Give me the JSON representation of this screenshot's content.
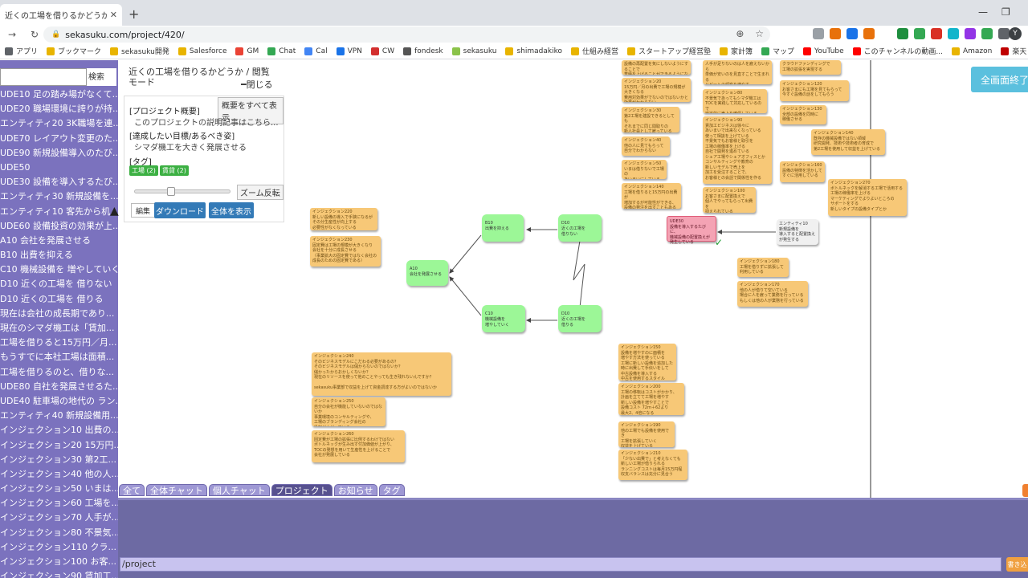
{
  "browser": {
    "tab_title": "近くの工場を借りるかどうか | 問題解",
    "tab_close": "✕",
    "new_tab": "+",
    "url": "sekasuku.com/project/420/",
    "lock": "🔒",
    "profile": "Y",
    "minimize": "—",
    "restore": "❐",
    "back": "←",
    "forward": "→",
    "reload": "↻",
    "zoom": "⊕",
    "star": "☆",
    "bookmarks": [
      {
        "label": "アプリ",
        "color": "#5f6368"
      },
      {
        "label": "ブックマーク",
        "color": "#e8b400"
      },
      {
        "label": "sekasuku開発",
        "color": "#e8b400"
      },
      {
        "label": "Salesforce",
        "color": "#e8b400"
      },
      {
        "label": "GM",
        "color": "#ea4335"
      },
      {
        "label": "Chat",
        "color": "#34a853"
      },
      {
        "label": "Cal",
        "color": "#4285f4"
      },
      {
        "label": "VPN",
        "color": "#1a73e8"
      },
      {
        "label": "CW",
        "color": "#d32f2f"
      },
      {
        "label": "fondesk",
        "color": "#555555"
      },
      {
        "label": "sekasuku",
        "color": "#8bc34a"
      },
      {
        "label": "shimadakiko",
        "color": "#e8b400"
      },
      {
        "label": "仕組み経営",
        "color": "#e8b400"
      },
      {
        "label": "スタートアップ経営塾",
        "color": "#e8b400"
      },
      {
        "label": "家計簿",
        "color": "#e8b400"
      },
      {
        "label": "マップ",
        "color": "#34a853"
      },
      {
        "label": "YouTube",
        "color": "#ff0000"
      },
      {
        "label": "このチャンネルの動画...",
        "color": "#ff0000"
      },
      {
        "label": "Amazon",
        "color": "#e8b400"
      },
      {
        "label": "楽天",
        "color": "#bf0000"
      },
      {
        "label": "楽天証券",
        "color": "#bf0000"
      }
    ]
  },
  "sidebar": {
    "search_button": "検索",
    "items": [
      "UDE10 足の踏み場がなくて...",
      "UDE20 職場環境に誇りが持...",
      "エンティティ20 3K職場を連...",
      "UDE70 レイアウト変更のた...",
      "UDE90 新規設備導入のたび...",
      "UDE50",
      "UDE30 設備を導入するたび...",
      "エンティティ30 新規設備を...",
      "エンティティ10 客先から机...",
      "UDE60 設備投資の効果が上...",
      "A10 会社を発展させる",
      "B10 出費を抑える",
      "C10 機械設備を 増やしていく",
      "D10 近くの工場を 借りない",
      "D10 近くの工場を 借りる",
      "現在は会社の成長期であり...",
      "現在のシマダ機工は「賃加...",
      "工場を借りると15万円／月...",
      "もうすでに本社工場は面積...",
      "工場を借りるのと、借りな...",
      "UDE80 自社を発展させるた...",
      "UDE40 駐車場の地代の ラン...",
      "エンティティ40 新規設備用...",
      "インジェクション10 出費の...",
      "インジェクション20 15万円...",
      "インジェクション30 第2工...",
      "インジェクション40 他の人...",
      "インジェクション50 いまは...",
      "インジェクション60 工場を...",
      "インジェクション70 人手が...",
      "インジェクション80 不景気...",
      "インジェクション110 クラ...",
      "インジェクション100 お客...",
      "インジェクション90 賃加工..."
    ]
  },
  "project_panel": {
    "title": "近くの工場を借りるかどうか / 閲覧モード",
    "close": "━閉じる",
    "show_all": "概要をすべて表示",
    "overview_label": "[プロジェクト概要]",
    "overview_text": "このプロジェクトの説明記事はこちら...",
    "goal_label": "[達成したい目標/あるべき姿]",
    "goal_text": "シマダ機工を大きく発展させる",
    "tag_label": "[タグ]",
    "tags": [
      "工場 (2)",
      "賃貸 (2)"
    ],
    "zoom_flip": "ズーム反転",
    "edit": "編集",
    "download": "ダウンロード",
    "show_all_view": "全体を表示"
  },
  "canvas": {
    "fullscreen": "全画面終了",
    "check": "✓",
    "green_nodes": {
      "a10": "A10\n会社を発展させる",
      "b10": "B10\n出費を抑える",
      "c10": "C10\n機械設備を\n増やしていく",
      "d10_top": "D10\n近くの工場を\n借りない",
      "d10_bottom": "D10\n近くの工場を\n借りる"
    },
    "pink_node": "UDE30\n設備を導入するたびに、\n機械設備の配置換えが\n発生している",
    "gray_node": "エンティティ10\n新規設備を\n導入すると配置換え\nが発生する",
    "notes": {
      "n220": "インジェクション220\n新しい設備の導入で手狭になるが\nその分生産性が向上する\n必要性がなくなっている",
      "n230": "インジェクション230\n固定費は工場の規模が大きくなり\n会社を十分に成長させる\n（事業拡大の固定費ではなく会社の\n成長のための固定費である）",
      "n240": "インジェクション240\nそのビジネスモデルにこだわる必要があるの？\nそのビジネスモデルは儲からないのではないか？\n儲かったからおかしくないか？\n現在のリソースを使って他のことやっても生き残れないんですか？\n\nsekasuku事業部で収益を上げて資金調達する方がよいのではないか",
      "n250": "インジェクション250\n自分の会社が機能していないのではないか\n事業環境のコンサルティングや、\n工場のブランディング会社の\n役割が上がっている",
      "n260": "インジェクション260\n固定費が工場の拡張に比例するわけではない\nボトルネックが生み出す付加価値が上がり、\nTOCの発想を用いて生産性を上げることで\n会社が発展している",
      "n1": "設備の再配置を気にしないようにすることで\n業績を上げることができるようになる",
      "n20": "インジェクション20\n15万円／月の出費で工場の規模が大きくなる\n費用対効果がでないのではないかと\n効果がわからない",
      "n30": "インジェクション30\n第2工場を建設できるとしても\nそれまでに同じ間取りの\n新人社員として雇っている",
      "n40": "インジェクション40\n他の人に見てもらって\n自分でわからない",
      "n50": "インジェクション50\nいまは借りないで工場の\nあいまいにしている",
      "n140r": "インジェクション140\n工場を借りると15万円の出費が\n増加するが可能性ができる、\n設備の発注を出すこともある",
      "n2": "人手が足りないのは人を雇えないから\n単価が安いのを見直すことで生まれる\nリピートの顧客を増やす\n人員を増やすことが出来ている",
      "n80": "インジェクション80\n不景気であってもシマダ機工は\nTOCを実践して対応しているので\n安定的に売上を確保している",
      "n90": "インジェクション90\n賃加工ビジネスは徐々に\nあいまいで出来なくなっている\n使って相談を上げている\n不景気でもお客様と取引を\n工場の稼働率を上げる\n自社で開発を進めている\nシェア工場やシェアオフィスとか\nコンサルティングや教育の\n新しいモデルで売上を\n加工を受注することで、\nお客様との会話で関係性を作る",
      "n100": "インジェクション100\nお客さまに配置換えで\n個人でやってもらって出費を\n抑えられている",
      "n3": "クラウドファンディングで\n工場の拡張を実現する",
      "n120": "インジェクション120\nお客さまにも工場を見てもらって\n今すぐ設備の話をしてもらう",
      "n130": "インジェクション130\n全部の設備を同時に\n稼働させる",
      "n140": "インジェクション140\n既存の機械設備ではない領域\n研究開発、技術や技術者の育成で\n第2工場を使用して収益を上げている",
      "n160": "インジェクション160\n設備の特徴を活かして\nすぐに活用している",
      "n270": "インジェクション270\nボトルネックを解消する工場で活用する\n工場の稼働率を上げる\nマーケティングでよりよいところの\nサポートをする\n新しいタイプの設備タイプとか",
      "n180": "インジェクション180\n工場を借りずに拡張して\n利用している",
      "n170": "インジェクション170\n他の人が借りて空いている\n場合に人を雇って業務を行っている\nもしくは他の人が業務を行っている",
      "n150": "インジェクション150\n設備を増やすのに面積を\n増やす方法を使っている\n工場に新しい設備を追加した\n時に出費して手伝いをして\n中古設備を導入する\n中古を使用するスタイル",
      "n200": "インジェクション200\n工場の移転はコストがかかり、\n計画を立てて工場を増やす\n新しい設備を増やすことで\n設備コスト 72ｍ＋62より\n最大2、4倍になる",
      "n190": "インジェクション190\n他の工場でも設備を使用でき\n工場を拡張していく\n収益を上げている",
      "n210": "インジェクション210\n「少ない出費で」と考えなくても\n新しい工場が借りられる\nランニングコストは毎月15万円程\n収支バランスは充分に見合う"
    }
  },
  "bottom": {
    "tabs": [
      "全て",
      "全体チャット",
      "個人チャット",
      "プロジェクト",
      "お知らせ",
      "タグ"
    ],
    "active_tab": "プロジェクト",
    "command": "/project",
    "send": "書き込"
  }
}
